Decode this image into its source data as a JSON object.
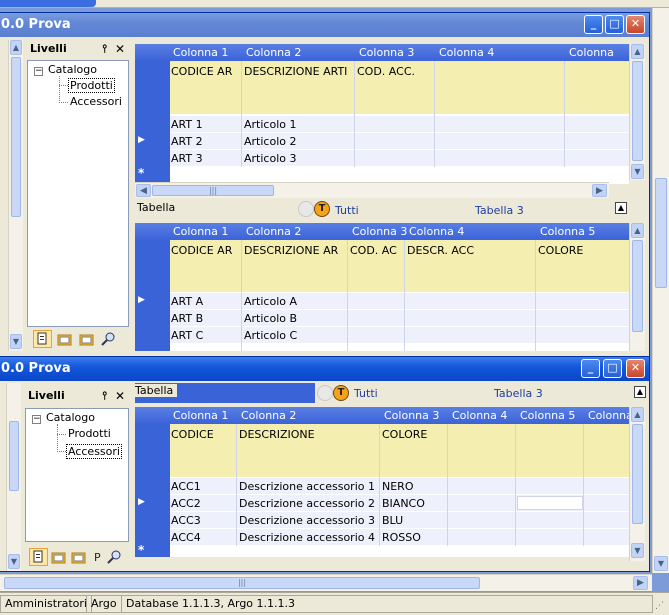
{
  "window_top": {
    "title": "0.0 Prova",
    "panel": {
      "title": "Livelli",
      "pin": "⫯",
      "close": "✕"
    },
    "tree": {
      "root": "Catalogo",
      "children": [
        "Prodotti",
        "Accessori"
      ],
      "selected": 0
    },
    "grid_top": {
      "columns": [
        "Colonna 1",
        "Colonna 2",
        "Colonna 3",
        "Colonna 4",
        "Colonna"
      ],
      "header_row": [
        "CODICE AR",
        "DESCRIZIONE ARTI",
        "COD. ACC."
      ],
      "rows": [
        [
          "ART 1",
          "Articolo 1"
        ],
        [
          "ART 2",
          "Articolo 2"
        ],
        [
          "ART 3",
          "Articolo 3"
        ]
      ]
    },
    "tabbar": {
      "label": "Tabella",
      "tab_all": "Tutti",
      "tab_3": "Tabella 3",
      "t_icon": "T"
    },
    "grid_bottom": {
      "columns": [
        "Colonna 1",
        "Colonna 2",
        "Colonna 3",
        "Colonna 4",
        "Colonna 5"
      ],
      "header_row": [
        "CODICE AR",
        "DESCRIZIONE AR",
        "COD. AC",
        "DESCR. ACC",
        "COLORE"
      ],
      "rows": [
        [
          "ART A",
          "Articolo A"
        ],
        [
          "ART B",
          "Articolo B"
        ],
        [
          "ART C",
          "Articolo C"
        ]
      ]
    }
  },
  "window_bottom": {
    "title": "0.0 Prova",
    "panel": {
      "title": "Livelli",
      "pin": "⫯",
      "close": "✕"
    },
    "tree": {
      "root": "Catalogo",
      "children": [
        "Prodotti",
        "Accessori"
      ],
      "selected": 1
    },
    "tabbar": {
      "label": "Tabella",
      "tab_all": "Tutti",
      "tab_3": "Tabella 3",
      "t_icon": "T"
    },
    "grid": {
      "columns": [
        "Colonna 1",
        "Colonna 2",
        "Colonna 3",
        "Colonna 4",
        "Colonna 5",
        "Colonna"
      ],
      "header_row": [
        "CODICE",
        "DESCRIZIONE",
        "COLORE"
      ],
      "rows": [
        [
          "ACC1",
          "Descrizione accessorio 1",
          "NERO"
        ],
        [
          "ACC2",
          "Descrizione accessorio 2",
          "BIANCO"
        ],
        [
          "ACC3",
          "Descrizione accessorio 3",
          "BLU"
        ],
        [
          "ACC4",
          "Descrizione accessorio 4",
          "ROSSO"
        ]
      ]
    }
  },
  "window_buttons": {
    "minimize": "_",
    "maximize": "□",
    "close": "✕"
  },
  "statusbar": {
    "user": "Amministratori",
    "db_name": "Argo",
    "version": "Database 1.1.1.3, Argo 1.1.1.3"
  },
  "colors": {
    "accent": "#3b63d8",
    "title": "#0a46c8",
    "header_yellow": "#f4eeb0"
  }
}
